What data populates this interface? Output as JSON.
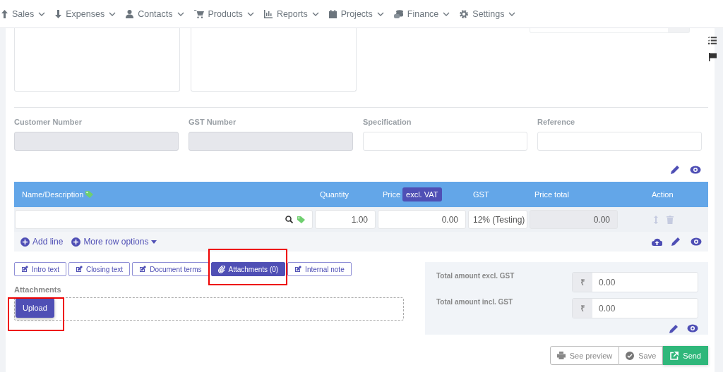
{
  "nav": [
    {
      "label": "Sales"
    },
    {
      "label": "Expenses"
    },
    {
      "label": "Contacts"
    },
    {
      "label": "Products"
    },
    {
      "label": "Reports"
    },
    {
      "label": "Projects"
    },
    {
      "label": "Finance"
    },
    {
      "label": "Settings"
    }
  ],
  "fields": [
    {
      "label": "Customer Number",
      "disabled": true
    },
    {
      "label": "GST Number",
      "disabled": true
    },
    {
      "label": "Specification",
      "disabled": false
    },
    {
      "label": "Reference",
      "disabled": false
    }
  ],
  "table": {
    "columns": [
      {
        "label": "Name/Description",
        "kind": "name"
      },
      {
        "label": "Quantity",
        "kind": "plain"
      },
      {
        "label": "Price",
        "kind": "price",
        "badge": "excl. VAT"
      },
      {
        "label": "GST",
        "kind": "plain"
      },
      {
        "label": "Price total",
        "kind": "plain"
      },
      {
        "label": "Action",
        "kind": "plain"
      }
    ],
    "rows": [
      {
        "quantity": "1.00",
        "price": "0.00",
        "gst": "12% (Testing)",
        "total": "0.00"
      }
    ],
    "footer": [
      "Add line",
      "More row options"
    ]
  },
  "tabs": [
    {
      "label": "Intro text",
      "selected": false,
      "highlighted": false
    },
    {
      "label": "Closing text",
      "selected": false,
      "highlighted": false
    },
    {
      "label": "Document terms",
      "selected": false,
      "highlighted": false
    },
    {
      "label": "Attachments (0)",
      "selected": true,
      "highlighted": true
    },
    {
      "label": "Internal note",
      "selected": false,
      "highlighted": false
    }
  ],
  "attachments": {
    "label": "Attachments",
    "button": "Upload",
    "highlighted": true
  },
  "totals": [
    {
      "label": "Total amount excl. GST",
      "currency": "₹",
      "value": "0.00"
    },
    {
      "label": "Total amount incl. GST",
      "currency": "₹",
      "value": "0.00"
    }
  ],
  "actions": [
    {
      "label": "See preview",
      "kind": "preview"
    },
    {
      "label": "Save",
      "kind": "save"
    },
    {
      "label": "Send",
      "kind": "send"
    }
  ]
}
